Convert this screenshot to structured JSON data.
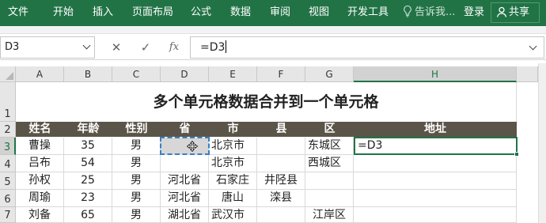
{
  "ribbon": {
    "tabs": [
      "文件",
      "开始",
      "插入",
      "页面布局",
      "公式",
      "数据",
      "审阅",
      "视图",
      "开发工具"
    ],
    "tell_me": "告诉我...",
    "login": "登录",
    "share": "共享",
    "colors": {
      "ribbon_bg": "#217346",
      "header_row_bg": "#5b5549"
    }
  },
  "formula_bar": {
    "name_box": "D3",
    "cancel_icon": "close-icon",
    "enter_icon": "check-icon",
    "function_label": "fx",
    "formula": "=D3"
  },
  "sheet": {
    "columns": [
      "A",
      "B",
      "C",
      "D",
      "E",
      "F",
      "G",
      "H"
    ],
    "rows": [
      "1",
      "2",
      "3",
      "4",
      "5",
      "6",
      "7"
    ],
    "title": "多个单元格数据合并到一个单元格",
    "headers": [
      "姓名",
      "年龄",
      "性别",
      "省",
      "市",
      "县",
      "区",
      "地址"
    ],
    "data": [
      [
        "曹操",
        "35",
        "男",
        "",
        "北京市",
        "",
        "东城区",
        "=D3"
      ],
      [
        "吕布",
        "54",
        "男",
        "",
        "北京市",
        "",
        "西城区",
        ""
      ],
      [
        "孙权",
        "25",
        "男",
        "河北省",
        "石家庄",
        "井陉县",
        "",
        ""
      ],
      [
        "周瑜",
        "23",
        "男",
        "河北省",
        "唐山",
        "滦县",
        "",
        ""
      ],
      [
        "刘备",
        "65",
        "男",
        "湖北省",
        "武汉市",
        "",
        "江岸区",
        ""
      ]
    ]
  }
}
